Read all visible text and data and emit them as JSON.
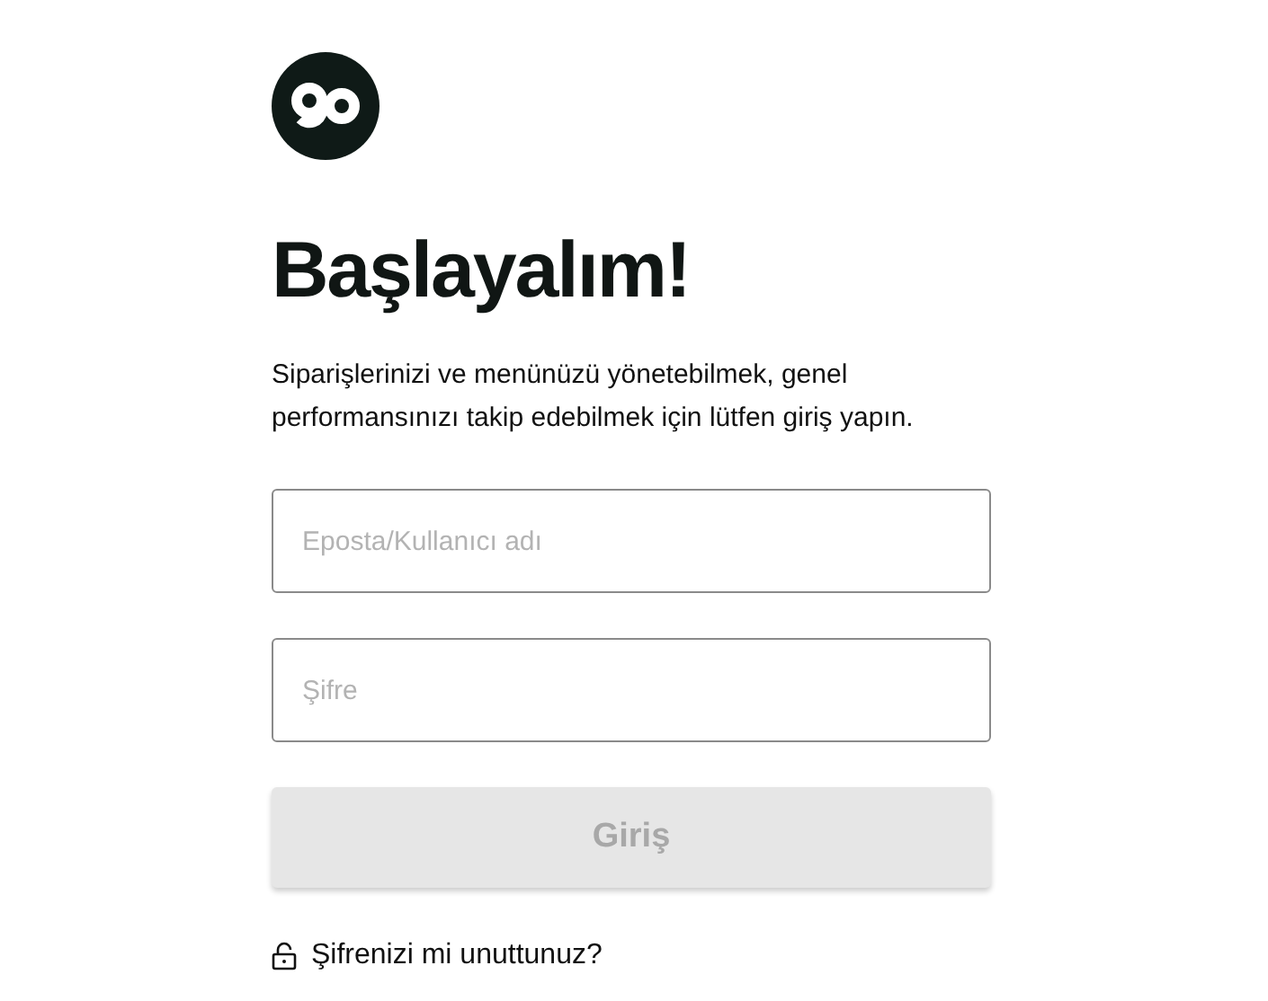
{
  "title": "Başlayalım!",
  "description": "Siparişlerinizi ve menünüzü yönetebilmek, genel performansınızı takip edebilmek için lütfen giriş yapın.",
  "fields": [
    {
      "placeholder": "Eposta/Kullanıcı adı"
    },
    {
      "placeholder": "Şifre"
    }
  ],
  "submit": {
    "label": "Giriş",
    "disabled": true
  },
  "forgot_link": "Şifrenizi mi unuttunuz?"
}
